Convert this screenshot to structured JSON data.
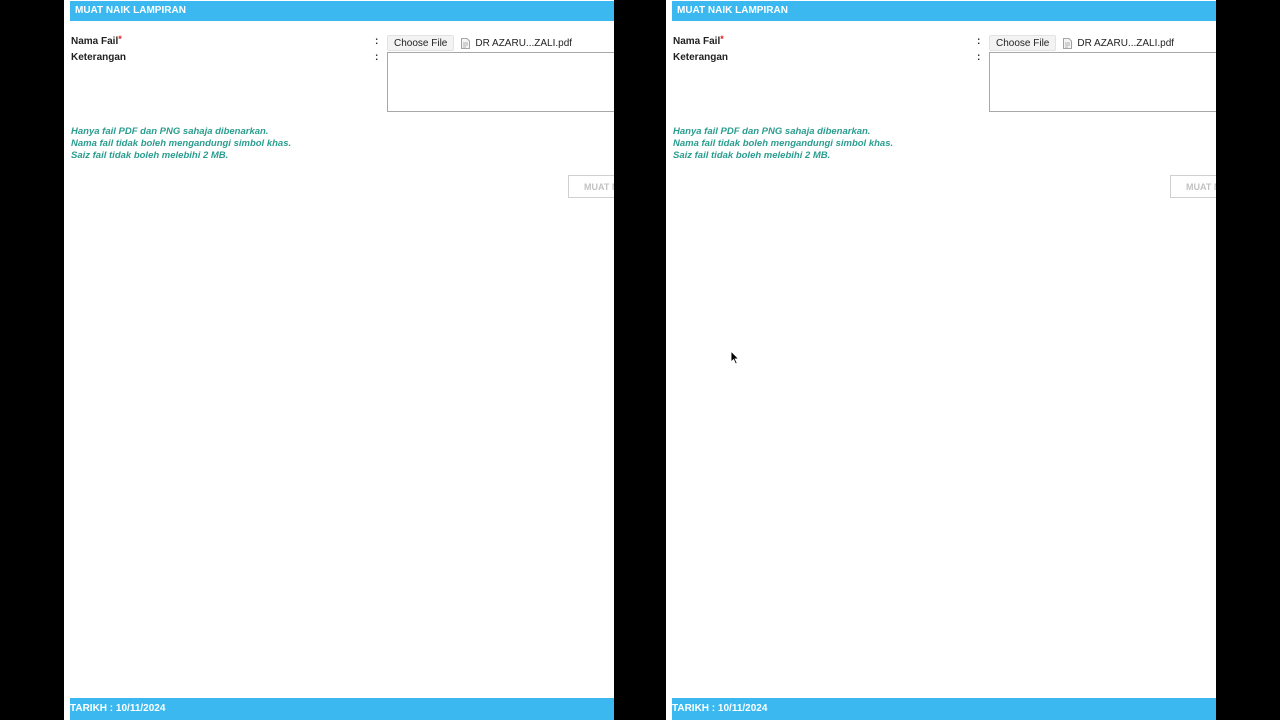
{
  "panes": [
    {
      "header": "MUAT NAIK LAMPIRAN",
      "nama_fail_label": "Nama Fail",
      "required_mark": "*",
      "keterangan_label": "Keterangan",
      "colon": ":",
      "choose_file_label": "Choose File",
      "selected_file": "DR AZARU...ZALI.pdf",
      "notes": [
        "Hanya fail PDF dan PNG sahaja dibenarkan.",
        "Nama fail tidak boleh mengandungi simbol khas.",
        "Saiz fail tidak boleh melebihi 2 MB."
      ],
      "upload_button": "MUAT NAIK",
      "footer": "TARIKH : 10/11/2024"
    },
    {
      "header": "MUAT NAIK LAMPIRAN",
      "nama_fail_label": "Nama Fail",
      "required_mark": "*",
      "keterangan_label": "Keterangan",
      "colon": ":",
      "choose_file_label": "Choose File",
      "selected_file": "DR AZARU...ZALI.pdf",
      "notes": [
        "Hanya fail PDF dan PNG sahaja dibenarkan.",
        "Nama fail tidak boleh mengandungi simbol khas.",
        "Saiz fail tidak boleh melebihi 2 MB."
      ],
      "upload_button": "MUAT NAIK",
      "footer": "TARIKH : 10/11/2024"
    }
  ],
  "colors": {
    "accent": "#3ab8ef",
    "note_text": "#2a9d8f",
    "required": "#e02020"
  }
}
